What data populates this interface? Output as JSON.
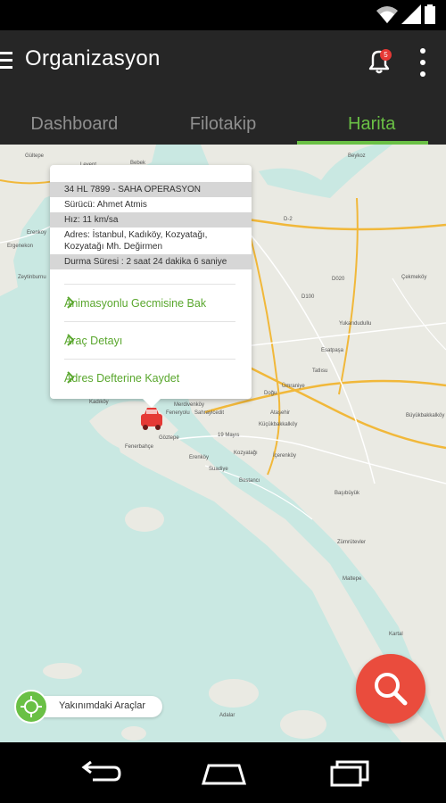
{
  "app": {
    "title": "Organizasyon",
    "notification_count": "5"
  },
  "tabs": [
    {
      "label": "Dashboard",
      "active": false
    },
    {
      "label": "Filotakip",
      "active": false
    },
    {
      "label": "Harita",
      "active": true
    }
  ],
  "popup": {
    "plate": "34 HL 7899 - SAHA OPERASYON",
    "driver": "Sürücü: Ahmet Atmis",
    "speed": "Hız: 11 km/sa",
    "address_line1": "Adres: İstanbul, Kadıköy, Kozyatağı,",
    "address_line2": "Kozyatağı Mh. Değirmen",
    "stop_duration": "Durma Süresi : 2 saat 24 dakika 6 saniye",
    "actions": [
      {
        "label": "Animasyonlu Gecmisine Bak"
      },
      {
        "label": "Araç Detayı"
      },
      {
        "label": "Adres Defterine Kaydet"
      }
    ]
  },
  "map": {
    "labels": [
      "Gültepe",
      "Bebek",
      "Levent",
      "Beykoz",
      "Ortaköy",
      "Zeytinburnu",
      "Erenkoy",
      "Ergenekon",
      "Bakırköy",
      "Kadıköy",
      "Mecidiyeköy",
      "Merdivenköy",
      "Feneryolu",
      "Ataşehir",
      "Küçükbakkalköy",
      "Göztepe",
      "Fenerbahçe",
      "Erenköy",
      "Kozyatağı",
      "İçerenköy",
      "Suadiye",
      "Bostancı",
      "Yukarıdudullu",
      "Çekmeköy",
      "Tatlısu",
      "Büyükbakkalköy",
      "Başıbüyük",
      "Zümrütevler",
      "Maltepe",
      "Kartal",
      "Adalar",
      "19 Mayıs",
      "Sahrayicedit",
      "Ümraniye",
      "Esatpaşa",
      "Doğu",
      "D100",
      "D020",
      "D-2",
      "O-1",
      "Kızıltoprak"
    ],
    "accent_green": "#6ac045",
    "marker_color": "#e53935"
  },
  "nearby": {
    "label": "Yakınımdaki Araçlar"
  },
  "icons": {
    "menu": "hamburger-menu-icon",
    "notifications": "bell-icon",
    "overflow": "more-vertical-icon",
    "car": "car-marker-icon",
    "search": "search-icon",
    "location": "locate-icon",
    "nav_back": "back-icon",
    "nav_home": "home-icon",
    "nav_recents": "recent-apps-icon"
  }
}
